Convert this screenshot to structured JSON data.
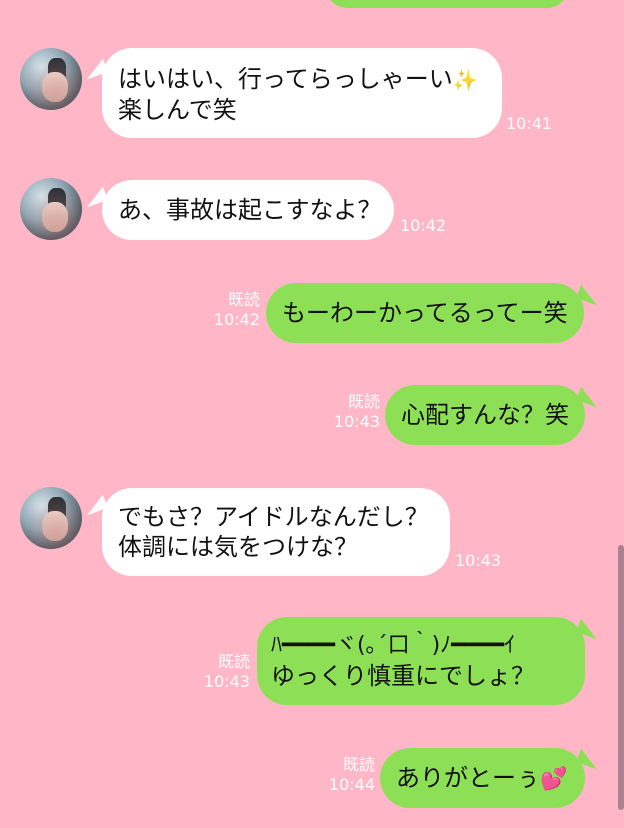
{
  "app": {
    "name": "LINE-style chat",
    "colors": {
      "background": "#FFB6C7",
      "incoming_bubble": "#FFFFFF",
      "outgoing_bubble": "#8DE055",
      "meta_text": "#FFFFFF"
    }
  },
  "messages": [
    {
      "id": "m1",
      "direction": "incoming",
      "lines": [
        "はいはい、行ってらっしゃーい",
        "楽しんで笑"
      ],
      "emoji": "✨",
      "time": "10:41"
    },
    {
      "id": "m2",
      "direction": "incoming",
      "lines": [
        "あ、事故は起こすなよ？"
      ],
      "time": "10:42"
    },
    {
      "id": "m3",
      "direction": "outgoing",
      "lines": [
        "もーわーかってるってー笑"
      ],
      "read": "既読",
      "time": "10:42"
    },
    {
      "id": "m4",
      "direction": "outgoing",
      "lines": [
        "心配すんな？笑"
      ],
      "read": "既読",
      "time": "10:43"
    },
    {
      "id": "m5",
      "direction": "incoming",
      "lines": [
        "でもさ？アイドルなんだし？",
        "体調には気をつけな？"
      ],
      "time": "10:43"
    },
    {
      "id": "m6",
      "direction": "outgoing",
      "lines": [
        "ﾊ━━━━ヾ(｡´口｀)ﾉ━━━━ｲ",
        "ゆっくり慎重にでしょ？"
      ],
      "read": "既読",
      "time": "10:43"
    },
    {
      "id": "m7",
      "direction": "outgoing",
      "lines": [
        "ありがとーぅ"
      ],
      "emoji": "💕",
      "read": "既読",
      "time": "10:44"
    }
  ]
}
